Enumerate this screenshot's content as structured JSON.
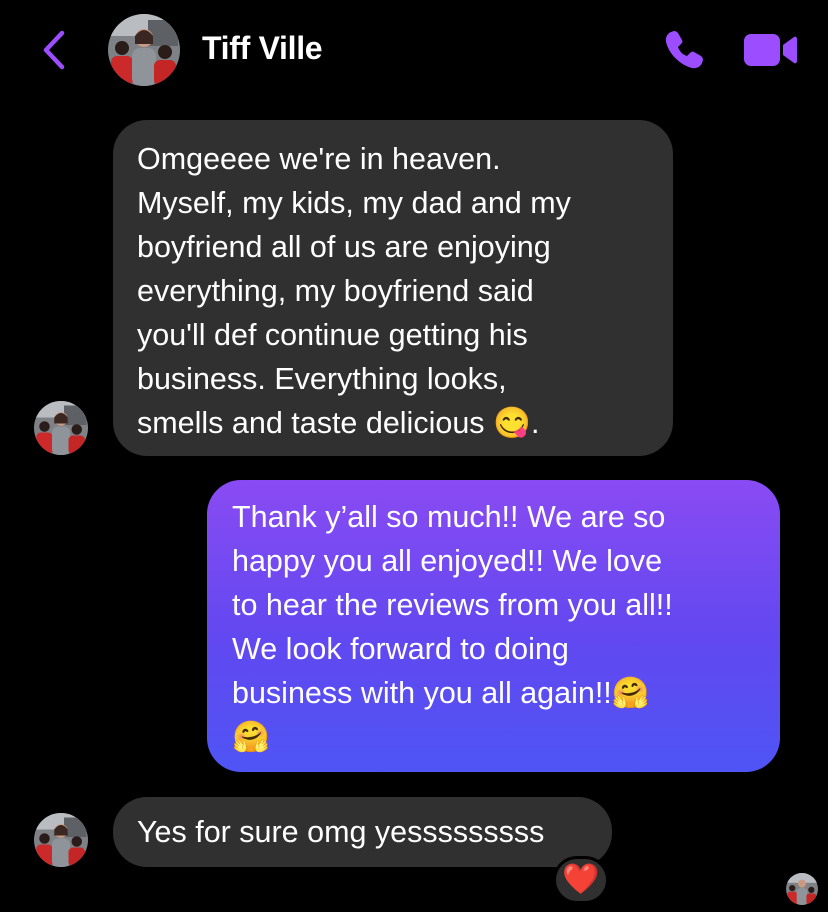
{
  "header": {
    "contact_name": "Tiff Ville",
    "accent_color": "#9b4dff"
  },
  "messages": [
    {
      "direction": "incoming",
      "text": "Omgeeee we're in heaven.\nMyself, my kids, my dad and my\nboyfriend all of us are enjoying\neverything, my boyfriend said\nyou'll def continue getting his\nbusiness. Everything looks,\nsmells and taste delicious 😋."
    },
    {
      "direction": "outgoing",
      "text": "Thank y’all so much!! We are so\nhappy you all enjoyed!! We love\nto hear the reviews from you all!!\nWe look forward to doing\nbusiness with you all again!!🤗\n🤗"
    },
    {
      "direction": "incoming",
      "text": "Yes for sure omg yesssssssss",
      "reaction": "❤️"
    }
  ],
  "colors": {
    "background": "#000000",
    "incoming_bubble": "#303030",
    "outgoing_gradient_top": "#8a4bf3",
    "outgoing_gradient_bottom": "#4f55f5",
    "reaction_heart": "#ff2a43"
  },
  "icons": {
    "back": "chevron-left-icon",
    "call": "phone-icon",
    "video": "video-camera-icon",
    "reaction": "heart-icon"
  }
}
